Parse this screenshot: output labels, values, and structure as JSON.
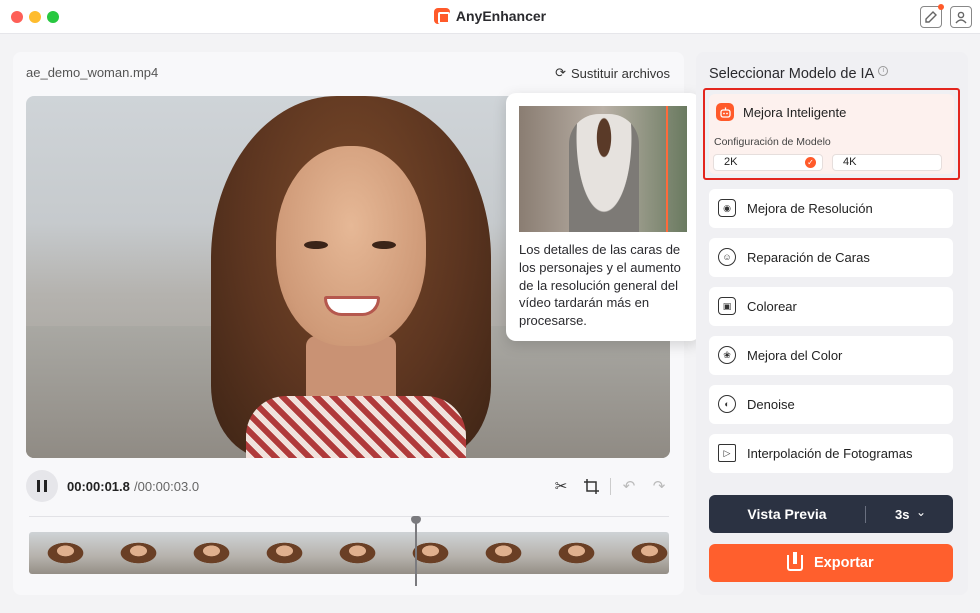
{
  "window": {
    "title": "AnyEnhancer"
  },
  "editor": {
    "filename": "ae_demo_woman.mp4",
    "replace_label": "Sustituir archivos",
    "time_current": "00:00:01.8",
    "time_total": "/00:00:03.0"
  },
  "tooltip": {
    "text": "Los detalles de las caras de los personajes y el aumento de la resolución general del vídeo tardarán más en procesarse."
  },
  "models": {
    "title": "Seleccionar Modelo de IA",
    "selected": {
      "label": "Mejora Inteligente",
      "config_label": "Configuración de Modelo",
      "options": [
        "2K",
        "4K"
      ],
      "selected_option": "2K"
    },
    "items": [
      {
        "label": "Mejora de Resolución",
        "icon": "resolution-icon"
      },
      {
        "label": "Reparación de Caras",
        "icon": "face-icon"
      },
      {
        "label": "Colorear",
        "icon": "colorize-icon"
      },
      {
        "label": "Mejora del Color",
        "icon": "color-enhance-icon"
      },
      {
        "label": "Denoise",
        "icon": "denoise-icon"
      },
      {
        "label": "Interpolación de Fotogramas",
        "icon": "frame-interpolation-icon"
      }
    ]
  },
  "actions": {
    "preview_label": "Vista Previa",
    "preview_duration": "3s",
    "export_label": "Exportar"
  },
  "colors": {
    "accent": "#ff5f2d",
    "highlight_border": "#e3261e",
    "dark_button": "#2b3242"
  }
}
